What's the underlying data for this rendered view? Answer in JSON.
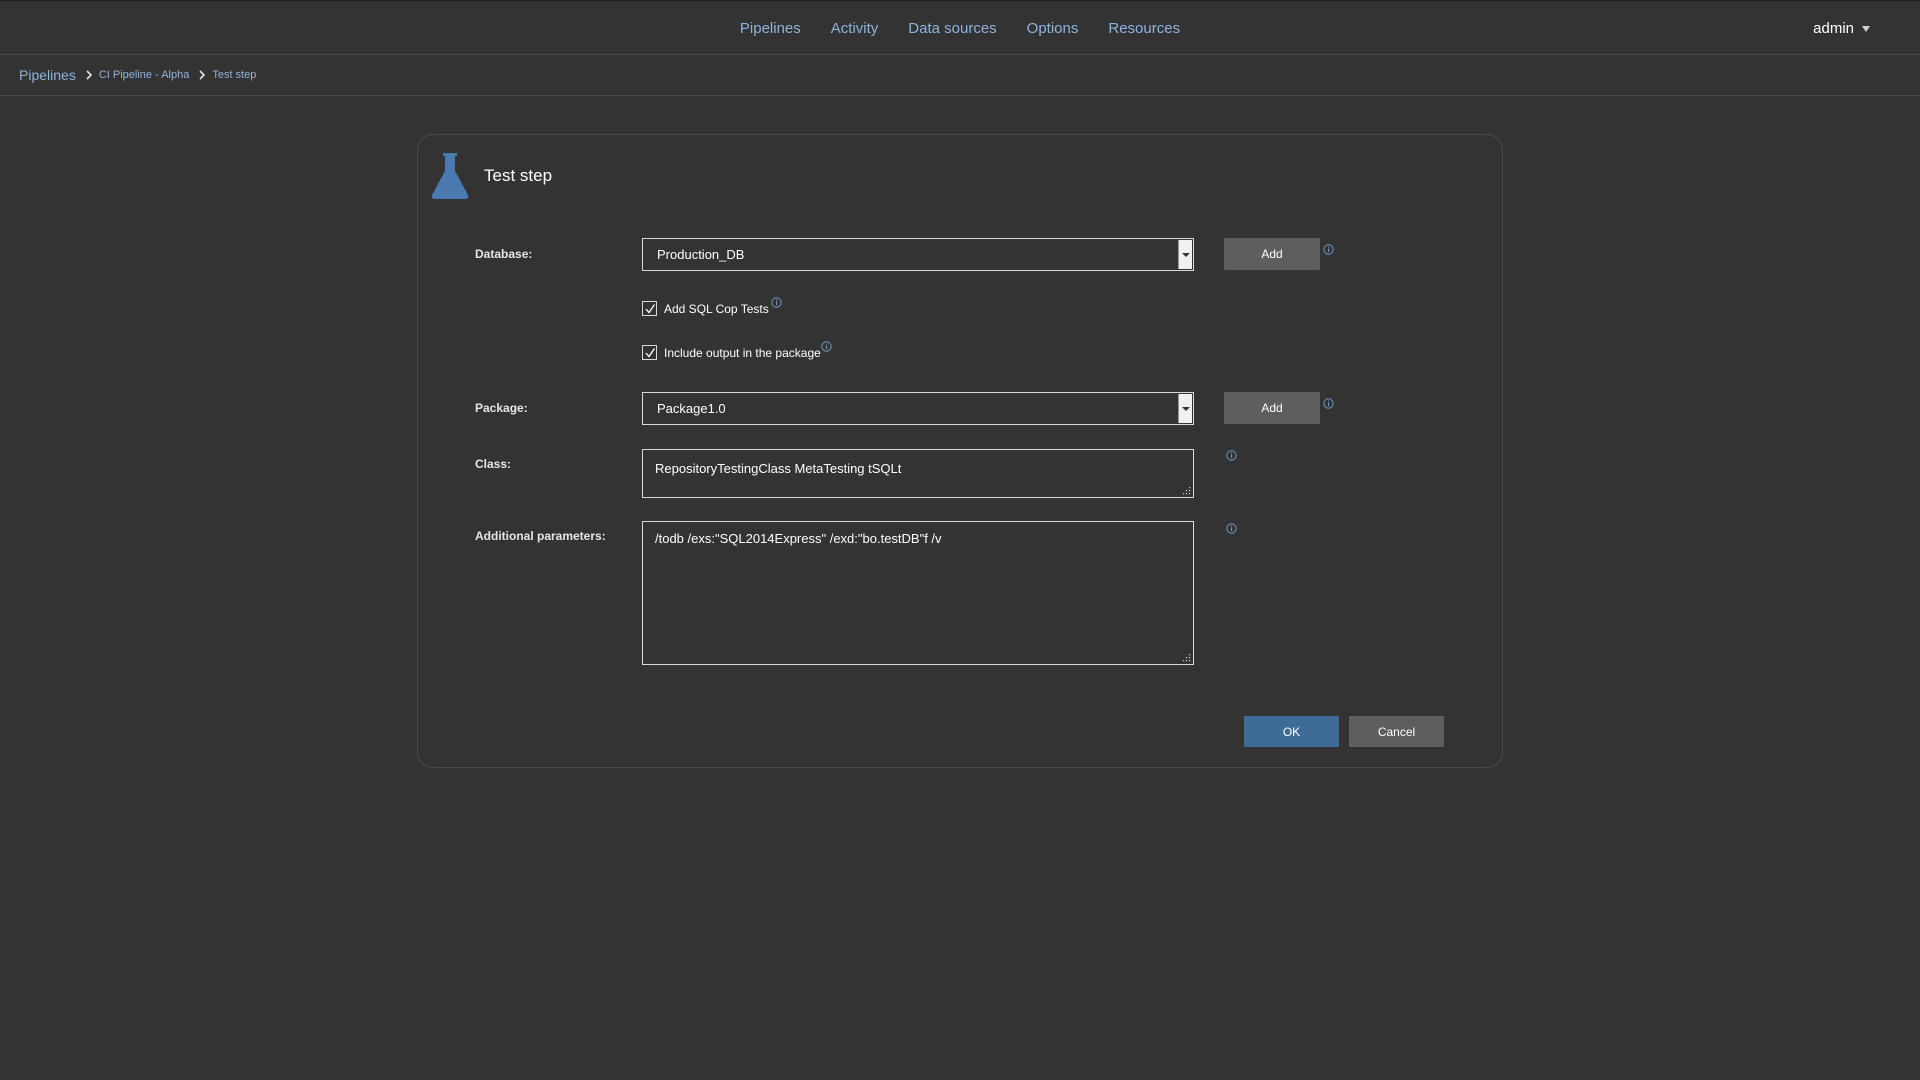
{
  "nav": {
    "items": [
      "Pipelines",
      "Activity",
      "Data sources",
      "Options",
      "Resources"
    ],
    "user": "admin"
  },
  "breadcrumb": [
    "Pipelines",
    "CI Pipeline - Alpha",
    "Test step"
  ],
  "dialog": {
    "title": "Test step",
    "icon": "flask-icon",
    "database": {
      "label": "Database:",
      "value": "Production_DB",
      "add_label": "Add"
    },
    "sql_cop": {
      "label": "Add SQL Cop Tests",
      "checked": true
    },
    "include_output": {
      "label": "Include output in the package",
      "checked": true
    },
    "package": {
      "label": "Package:",
      "value": "Package1.0",
      "add_label": "Add"
    },
    "class": {
      "label": "Class:",
      "value": "RepositoryTestingClass MetaTesting tSQLt"
    },
    "additional_parameters": {
      "label": "Additional parameters:",
      "value": "/todb /exs:\"SQL2014Express\" /exd:\"bo.testDB\"f /v"
    },
    "ok_label": "OK",
    "cancel_label": "Cancel"
  },
  "colors": {
    "background": "#333333",
    "link": "#8fb3dd",
    "primary_button": "#3f6b99",
    "secondary_button": "#5e5e5e",
    "icon_accent": "#4a7ab0"
  }
}
